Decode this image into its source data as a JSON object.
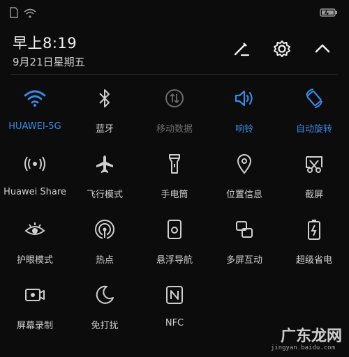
{
  "colors": {
    "accent": "#3a8ae6",
    "background": "#0c0c0c",
    "dim": "#6b6b6b"
  },
  "status_bar": {
    "icons": [
      "sim-icon",
      "wifi-icon",
      "battery-icon"
    ]
  },
  "header": {
    "time": "早上8:19",
    "date": "9月21日星期五",
    "actions": [
      "edit-icon",
      "gear-icon",
      "chevron-up-icon"
    ]
  },
  "tiles": [
    {
      "label": "HUAWEI-5G",
      "icon": "wifi-icon",
      "state": "on"
    },
    {
      "label": "蓝牙",
      "icon": "bluetooth-icon",
      "state": "off"
    },
    {
      "label": "移动数据",
      "icon": "mobile-data-icon",
      "state": "disabled"
    },
    {
      "label": "响铃",
      "icon": "sound-icon",
      "state": "on"
    },
    {
      "label": "自动旋转",
      "icon": "auto-rotate-icon",
      "state": "on"
    },
    {
      "label": "Huawei Share",
      "icon": "huawei-share-icon",
      "state": "off"
    },
    {
      "label": "飞行模式",
      "icon": "airplane-icon",
      "state": "off"
    },
    {
      "label": "手电筒",
      "icon": "flashlight-icon",
      "state": "off"
    },
    {
      "label": "位置信息",
      "icon": "location-icon",
      "state": "off"
    },
    {
      "label": "截屏",
      "icon": "screenshot-icon",
      "state": "off"
    },
    {
      "label": "护眼模式",
      "icon": "eye-comfort-icon",
      "state": "off"
    },
    {
      "label": "热点",
      "icon": "hotspot-icon",
      "state": "off"
    },
    {
      "label": "悬浮导航",
      "icon": "floating-nav-icon",
      "state": "off"
    },
    {
      "label": "多屏互动",
      "icon": "multi-screen-icon",
      "state": "off"
    },
    {
      "label": "超级省电",
      "icon": "ultra-power-saving-icon",
      "state": "off"
    },
    {
      "label": "屏幕录制",
      "icon": "screen-record-icon",
      "state": "off"
    },
    {
      "label": "免打扰",
      "icon": "do-not-disturb-icon",
      "state": "off"
    },
    {
      "label": "NFC",
      "icon": "nfc-icon",
      "state": "off"
    }
  ],
  "watermark": {
    "main": "广东龙网",
    "sub": "jingyan.baidu.com"
  }
}
